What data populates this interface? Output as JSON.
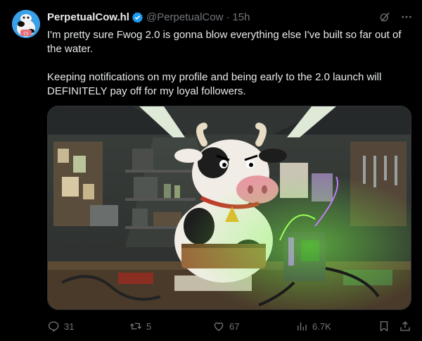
{
  "tweet": {
    "display_name": "PerpetualCow.hl",
    "handle": "@PerpetualCow",
    "separator": "·",
    "time": "15h",
    "text": "I'm pretty sure Fwog 2.0 is gonna blow everything else I've built so far out of the water.\n\nKeeping notifications on my profile and being early to the 2.0 launch will DEFINITELY pay off for my loyal followers."
  },
  "actions": {
    "replies": "31",
    "reposts": "5",
    "likes": "67",
    "views": "6.7K"
  },
  "icons": {
    "verified": "verified-badge-icon",
    "grok": "grok-icon",
    "more": "more-icon",
    "reply": "reply-icon",
    "repost": "repost-icon",
    "like": "like-icon",
    "views": "views-icon",
    "bookmark": "bookmark-icon",
    "share": "share-icon"
  },
  "colors": {
    "background": "#000000",
    "text": "#e7e9ea",
    "muted": "#71767b",
    "verified": "#1d9bf0"
  }
}
